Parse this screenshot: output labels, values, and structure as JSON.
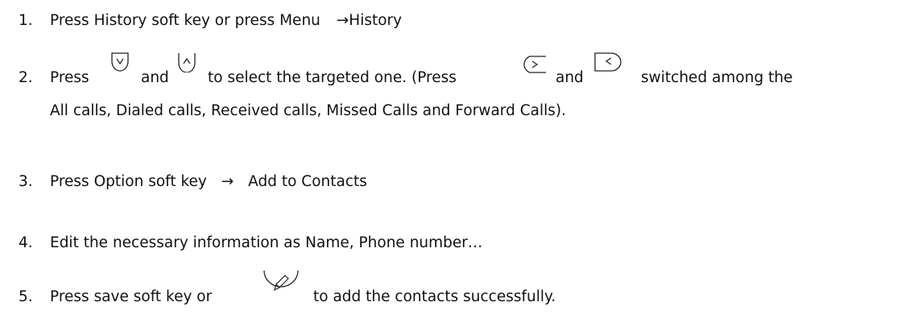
{
  "steps": [
    {
      "number": "1.",
      "text_a": "Press History soft key or press Menu",
      "arrow": "→",
      "text_b": "History"
    },
    {
      "number": "2.",
      "press": "Press",
      "and1": "and",
      "mid": "to select the targeted one. (Press",
      "and2": "and",
      "end": "switched among the",
      "cont": "All calls, Dialed calls, Received calls, Missed Calls and Forward Calls).",
      "icons": [
        "down-key-icon",
        "up-key-icon",
        "right-key-icon",
        "left-key-icon"
      ]
    },
    {
      "number": "3.",
      "text_a": "Press Option soft key",
      "arrow": "→",
      "text_b": "Add to Contacts"
    },
    {
      "number": "4.",
      "text": "Edit the necessary information as Name, Phone number…"
    },
    {
      "number": "5.",
      "text_a": "Press save soft key or",
      "text_b": "to add the contacts successfully.",
      "icon": "ok-key-icon"
    }
  ]
}
